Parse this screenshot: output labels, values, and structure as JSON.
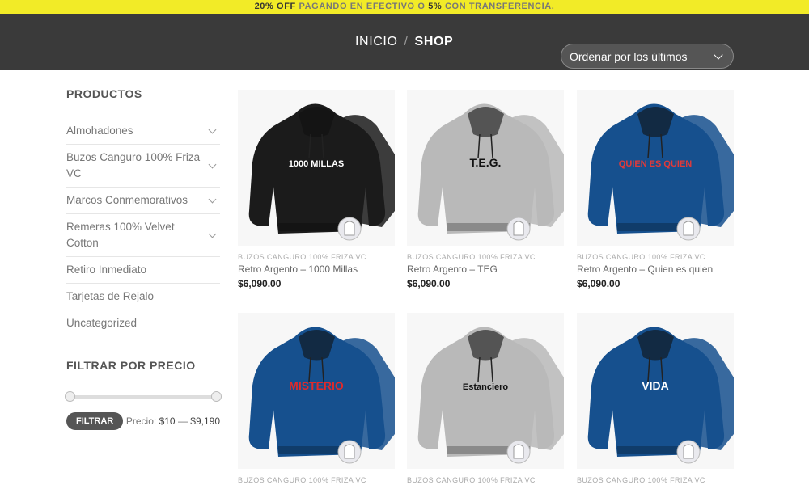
{
  "promo": {
    "part1": "20% OFF",
    "part2": " PAGANDO EN EFECTIVO O ",
    "part3": "5%",
    "part4": " CON TRANSFERENCIA."
  },
  "breadcrumb": {
    "home": "INICIO",
    "separator": "/",
    "current": "SHOP"
  },
  "sort": {
    "selected": "Ordenar por los últimos"
  },
  "sidebar": {
    "title": "PRODUCTOS",
    "categories": [
      {
        "label": "Almohadones",
        "expandable": true
      },
      {
        "label": "Buzos Canguro 100% Friza VC",
        "expandable": true
      },
      {
        "label": "Marcos Conmemorativos",
        "expandable": true
      },
      {
        "label": "Remeras 100% Velvet Cotton",
        "expandable": true
      },
      {
        "label": "Retiro Inmediato",
        "expandable": false
      },
      {
        "label": "Tarjetas de Rejalo",
        "expandable": false
      },
      {
        "label": "Uncategorized",
        "expandable": false
      }
    ],
    "price_filter": {
      "title": "FILTRAR POR PRECIO",
      "button": "FILTRAR",
      "label": "Precio:",
      "min": "$10",
      "dash": "—",
      "max": "$9,190"
    }
  },
  "products": [
    {
      "category": "BUZOS CANGURO 100% FRIZA VC",
      "name": "Retro Argento – 1000 Millas",
      "price": "$6,090.00",
      "color": "#1b1b1b",
      "print": "1000 MILLAS",
      "print_color": "#ffffff"
    },
    {
      "category": "BUZOS CANGURO 100% FRIZA VC",
      "name": "Retro Argento – TEG",
      "price": "$6,090.00",
      "color": "#b9b9b9",
      "print": "T.E.G.",
      "print_color": "#111111"
    },
    {
      "category": "BUZOS CANGURO 100% FRIZA VC",
      "name": "Retro Argento – Quien es quien",
      "price": "$6,090.00",
      "color": "#16508e",
      "print": "QUIEN ES QUIEN",
      "print_color": "#e03a3a"
    },
    {
      "category": "BUZOS CANGURO 100% FRIZA VC",
      "name": "",
      "price": "",
      "color": "#16508e",
      "print": "MISTERIO",
      "print_color": "#e02a2a"
    },
    {
      "category": "BUZOS CANGURO 100% FRIZA VC",
      "name": "",
      "price": "",
      "color": "#b9b9b9",
      "print": "Estanciero",
      "print_color": "#111111"
    },
    {
      "category": "BUZOS CANGURO 100% FRIZA VC",
      "name": "",
      "price": "",
      "color": "#16508e",
      "print": "VIDA",
      "print_color": "#ffffff"
    }
  ]
}
